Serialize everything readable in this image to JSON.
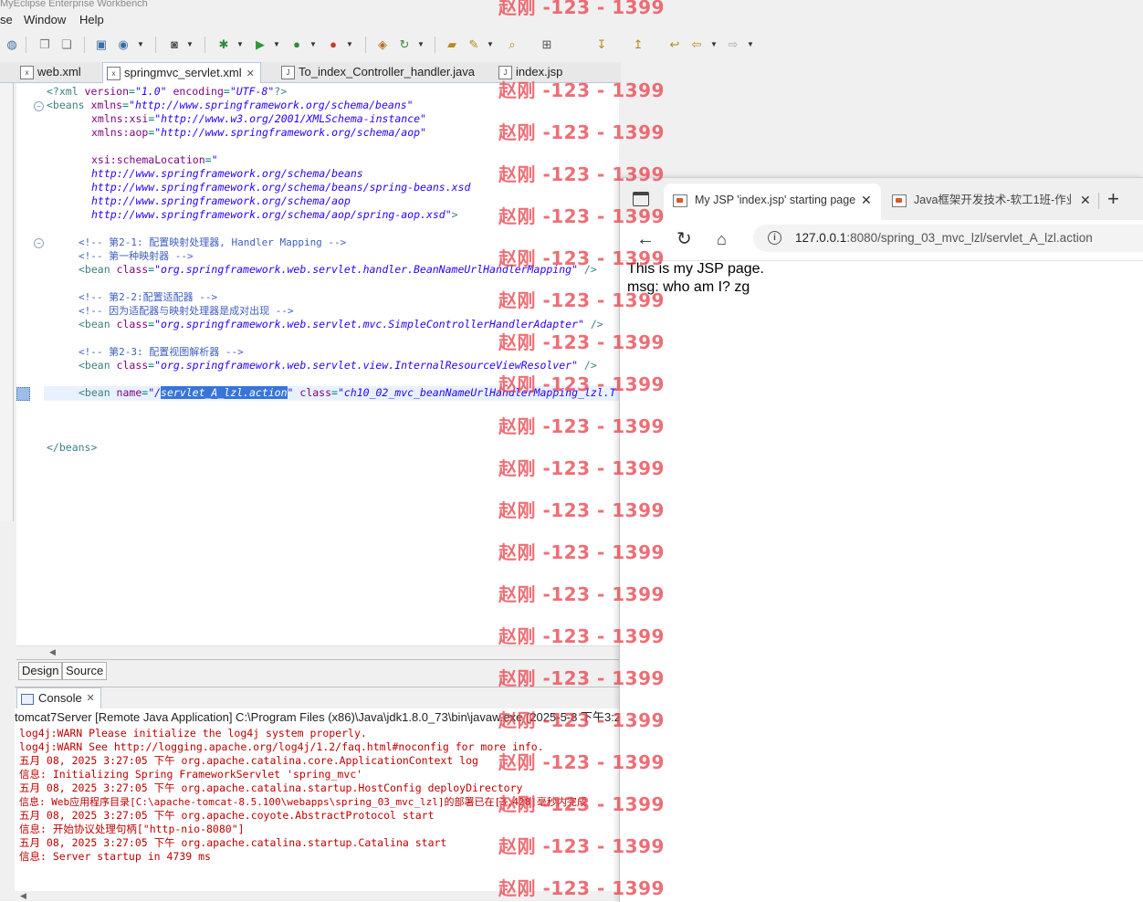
{
  "app": {
    "title": "MyEclipse Enterprise Workbench"
  },
  "menu": {
    "items": [
      "se",
      "Window",
      "Help"
    ]
  },
  "editor_tabs": [
    {
      "label": "web.xml",
      "icon": "xml-file-icon"
    },
    {
      "label": "springmvc_servlet.xml",
      "icon": "xml-file-icon",
      "active": true,
      "close": "✕"
    },
    {
      "label": "To_index_Controller_handler.java",
      "icon": "java-file-icon"
    },
    {
      "label": "index.jsp",
      "icon": "jsp-file-icon"
    }
  ],
  "code": {
    "l1": {
      "a": "<?xml ",
      "b": "version",
      "c": "=",
      "d": "\"1.0\"",
      "e": " encoding",
      "f": "=",
      "g": "\"UTF-8\"",
      "h": "?>"
    },
    "l2": {
      "a": "<beans ",
      "b": "xmlns",
      "c": "=",
      "d": "\"http://www.springframework.org/schema/beans\""
    },
    "l3": {
      "b": "xmlns:xsi",
      "c": "=",
      "d": "\"http://www.w3.org/2001/XMLSchema-instance\""
    },
    "l4": {
      "b": "xmlns:aop",
      "c": "=",
      "d": "\"http://www.springframework.org/schema/aop\""
    },
    "l5": {
      "b": "xsi:schemaLocation",
      "c": "=",
      "d": "\""
    },
    "l6": "http://www.springframework.org/schema/beans",
    "l7": "http://www.springframework.org/schema/beans/spring-beans.xsd",
    "l8": "http://www.springframework.org/schema/aop",
    "l9": {
      "d": "http://www.springframework.org/schema/aop/spring-aop.xsd\"",
      "h": ">"
    },
    "c1": "<!-- 第2-1: 配置映射处理器, Handler Mapping -->",
    "c2": "<!-- 第一种映射器 -->",
    "b1": {
      "a": "<bean ",
      "b": "class",
      "c": "=",
      "d": "\"org.springframework.web.servlet.handler.BeanNameUrlHandlerMapping\"",
      "h": " />"
    },
    "c3": "<!-- 第2-2:配置适配器 -->",
    "c4": "<!-- 因为适配器与映射处理器是成对出现 -->",
    "b2": {
      "a": "<bean ",
      "b": "class",
      "c": "=",
      "d": "\"org.springframework.web.servlet.mvc.SimpleControllerHandlerAdapter\"",
      "h": " />"
    },
    "c5": "<!-- 第2-3: 配置视图解析器 -->",
    "b3": {
      "a": "<bean ",
      "b": "class",
      "c": "=",
      "d": "\"org.springframework.web.servlet.view.InternalResourceViewResolver\"",
      "h": " />"
    },
    "b4": {
      "a": "<bean ",
      "b": "name",
      "c": "=",
      "q": "\"/",
      "sel": "servlet_A_lzl.action",
      "q2": "\"",
      "b2": " class",
      "c2": "=",
      "d": "\"ch10_02_mvc_beanNameUrlHandlerMapping_lzl.T"
    },
    "end": "</beans>"
  },
  "bottom_tabs": {
    "design": "Design",
    "source": "Source"
  },
  "console": {
    "tab": "Console",
    "close": "✕",
    "header": "tomcat7Server [Remote Java Application] C:\\Program Files (x86)\\Java\\jdk1.8.0_73\\bin\\javaw.exe (2025-5-8 下午3:2",
    "lines": [
      "log4j:WARN Please initialize the log4j system properly.",
      "log4j:WARN See http://logging.apache.org/log4j/1.2/faq.html#noconfig for more info.",
      "五月 08, 2025 3:27:05 下午 org.apache.catalina.core.ApplicationContext log",
      "信息: Initializing Spring FrameworkServlet 'spring_mvc'",
      "五月 08, 2025 3:27:05 下午 org.apache.catalina.startup.HostConfig deployDirectory",
      "信息: Web应用程序目录[C:\\apache-tomcat-8.5.100\\webapps\\spring_03_mvc_lzl]的部署已在[3,428]毫秒内完成",
      "五月 08, 2025 3:27:05 下午 org.apache.coyote.AbstractProtocol start",
      "信息: 开始协议处理句柄[\"http-nio-8080\"]",
      "五月 08, 2025 3:27:05 下午 org.apache.catalina.startup.Catalina start",
      "信息: Server startup in 4739 ms"
    ]
  },
  "browser": {
    "tabs": [
      {
        "label": "My JSP 'index.jsp' starting page",
        "close": "✕",
        "active": true
      },
      {
        "label": "Java框架开发技术-软工1班-作业",
        "close": "✕"
      }
    ],
    "new_tab": "+",
    "url_host": "127.0.0.1",
    "url_path": ":8080/spring_03_mvc_lzl/servlet_A_lzl.action",
    "page_line1": "This is my JSP page.",
    "page_line2": "msg: who am I? zg"
  },
  "watermark": "赵刚 -123 - 1399",
  "colors": {
    "watermark": "#e84650",
    "selection": "#3875d7",
    "xml_attr": "#7f007f",
    "xml_value": "#2a00ff",
    "xml_comment": "#3f5fbf"
  }
}
